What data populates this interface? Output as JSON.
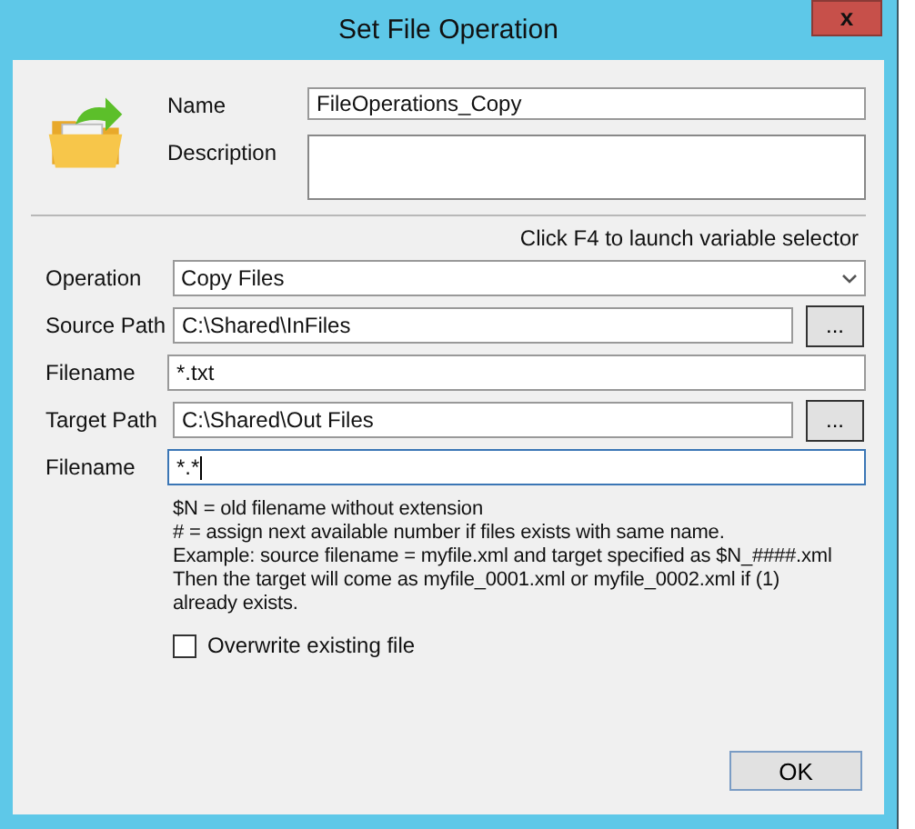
{
  "window": {
    "title": "Set File Operation",
    "close": "x"
  },
  "header": {
    "name_label": "Name",
    "name_value": "FileOperations_Copy",
    "description_label": "Description"
  },
  "hint": "Click F4 to launch variable selector",
  "rows": [
    {
      "kind": "select",
      "label": "Operation",
      "value": "Copy Files",
      "focused": false
    },
    {
      "kind": "path",
      "label": "Source Path",
      "value": "C:\\Shared\\InFiles",
      "button": "...",
      "focused": false
    },
    {
      "kind": "text",
      "label": "Filename",
      "value": "*.txt",
      "focused": false
    },
    {
      "kind": "path",
      "label": "Target Path",
      "value": "C:\\Shared\\Out Files",
      "button": "...",
      "focused": false
    },
    {
      "kind": "text",
      "label": "Filename",
      "value": "*.*",
      "focused": true
    }
  ],
  "help_lines": [
    "$N = old filename without extension",
    "# = assign next available number if files exists with same name.",
    "Example: source filename = myfile.xml and target specified as $N_####.xml",
    "Then the target will come as myfile_0001.xml or myfile_0002.xml if (1)",
    "already exists."
  ],
  "overwrite": {
    "label": "Overwrite existing file",
    "checked": false
  },
  "ok_button": "OK"
}
